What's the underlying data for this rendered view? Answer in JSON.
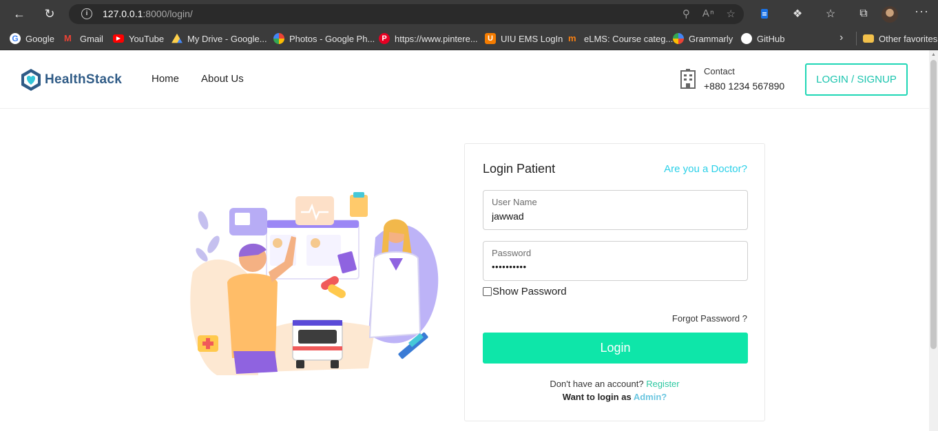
{
  "browser": {
    "url_host": "127.0.0.1",
    "url_path": ":8000/login/",
    "bookmarks": [
      {
        "label": "Google",
        "color": "#ffffff"
      },
      {
        "label": "Gmail",
        "color": "#ea4335"
      },
      {
        "label": "YouTube",
        "color": "#ff0000"
      },
      {
        "label": "My Drive - Google...",
        "color": "#1fa463"
      },
      {
        "label": "Photos - Google Ph...",
        "color": "#fbbc04"
      },
      {
        "label": "https://www.pintere...",
        "color": "#e60023"
      },
      {
        "label": "UIU EMS LogIn",
        "color": "#f57c00"
      },
      {
        "label": "eLMS: Course categ...",
        "color": "#f98012"
      },
      {
        "label": "Grammarly",
        "color": "#15c39a"
      },
      {
        "label": "GitHub",
        "color": "#ffffff"
      }
    ],
    "other_favorites": "Other favorites"
  },
  "header": {
    "brand": "HealthStack",
    "nav": [
      "Home",
      "About Us"
    ],
    "contact_label": "Contact",
    "contact_phone": "+880 1234 567890",
    "login_signup": "LOGIN / SIGNUP"
  },
  "login": {
    "title": "Login Patient",
    "doctor_link": "Are you a Doctor?",
    "username_label": "User Name",
    "username_value": "jawwad",
    "password_label": "Password",
    "password_value": "••••••••••",
    "show_password": "Show Password",
    "forgot": "Forgot Password ?",
    "login_button": "Login",
    "no_account": "Don't have an account?",
    "register": "Register",
    "admin_prefix": "Want to login as",
    "admin_link": "Admin?"
  },
  "colors": {
    "accent": "#0ee6a9",
    "link": "#2ad0e8",
    "brand": "#2f5b86"
  }
}
